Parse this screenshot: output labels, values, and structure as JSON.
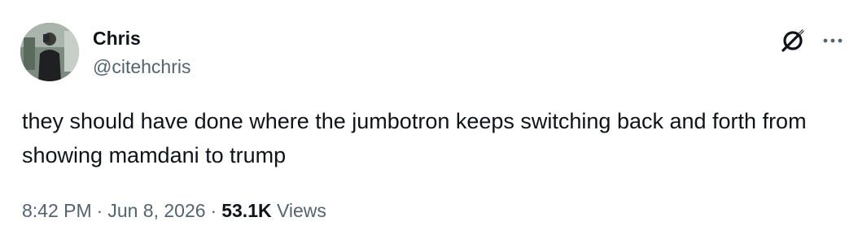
{
  "author": {
    "display_name": "Chris",
    "handle": "@citehchris"
  },
  "tweet": {
    "text": "they should have done where the jumbotron keeps switching back and forth from showing mamdani to trump"
  },
  "meta": {
    "time": "8:42 PM",
    "separator": "·",
    "date": "Jun 8, 2026",
    "views_count": "53.1K",
    "views_label": "Views"
  },
  "icons": {
    "grok": "grok-icon",
    "more": "more-horizontal-icon"
  }
}
